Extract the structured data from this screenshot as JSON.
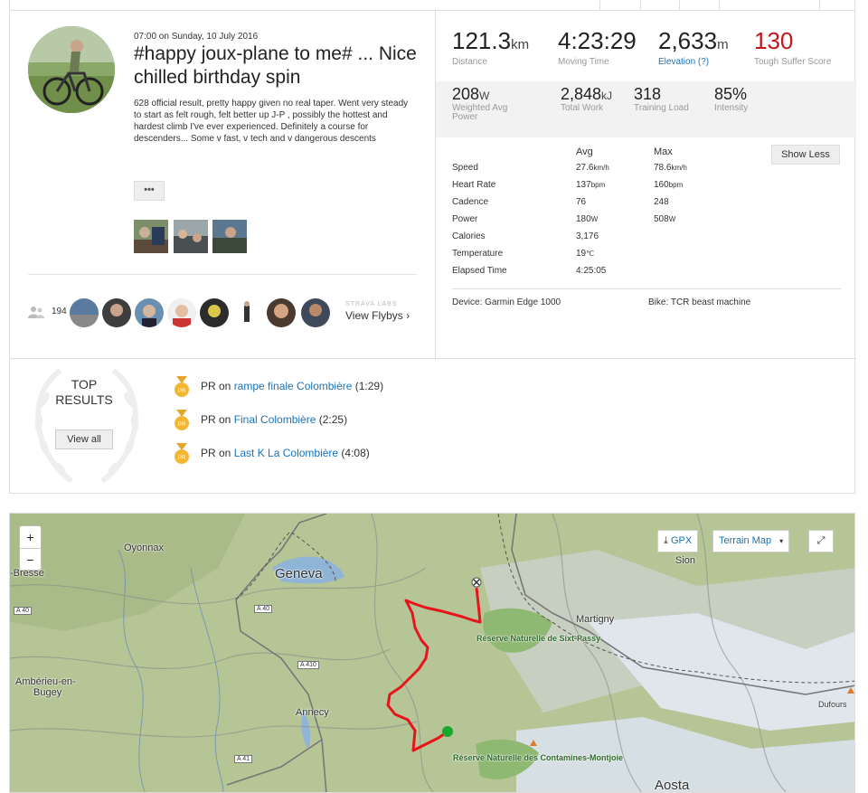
{
  "activity": {
    "date": "07:00 on Sunday, 10 July 2016",
    "title": "#happy joux-plane to me# ... Nice chilled birthday spin",
    "description": "628 official result, pretty happy given no real taper. Went very steady to start as felt rough, felt better up J-P , possibly the hottest and hardest climb I've ever experienced. Definitely a course for descenders... Some v fast, v tech and v dangerous descents",
    "more_label": "•••",
    "photos": [
      "photo-1",
      "photo-2",
      "photo-3"
    ]
  },
  "kudos": {
    "count": "194",
    "labs_label": "STRAVA LABS",
    "flyby_label": "View Flybys ›"
  },
  "stats": {
    "distance": {
      "value": "121.3",
      "unit": "km",
      "label": "Distance"
    },
    "moving_time": {
      "value": "4:23:29",
      "label": "Moving Time"
    },
    "elevation": {
      "value": "2,633",
      "unit": "m",
      "label": "Elevation (?)"
    },
    "suffer": {
      "value": "130",
      "label": "Tough Suffer Score"
    },
    "weighted_power": {
      "value": "208",
      "unit": "W",
      "label": "Weighted Avg Power"
    },
    "total_work": {
      "value": "2,848",
      "unit": "kJ",
      "label": "Total Work"
    },
    "training_load": {
      "value": "318",
      "label": "Training Load"
    },
    "intensity": {
      "value": "85%",
      "label": "Intensity"
    }
  },
  "details": {
    "avg_header": "Avg",
    "max_header": "Max",
    "show_less_label": "Show Less",
    "rows": [
      {
        "label": "Speed",
        "avg": "27.6",
        "avg_unit": "km/h",
        "max": "78.6",
        "max_unit": "km/h"
      },
      {
        "label": "Heart Rate",
        "avg": "137",
        "avg_unit": "bpm",
        "max": "160",
        "max_unit": "bpm"
      },
      {
        "label": "Cadence",
        "avg": "76",
        "avg_unit": "",
        "max": "248",
        "max_unit": ""
      },
      {
        "label": "Power",
        "avg": "180",
        "avg_unit": "W",
        "max": "508",
        "max_unit": "W"
      },
      {
        "label": "Calories",
        "avg": "3,176",
        "avg_unit": "",
        "max": "",
        "max_unit": ""
      },
      {
        "label": "Temperature",
        "avg": "19",
        "avg_unit": "℃",
        "max": "",
        "max_unit": ""
      },
      {
        "label": "Elapsed Time",
        "avg": "4:25:05",
        "avg_unit": "",
        "max": "",
        "max_unit": ""
      }
    ],
    "device": "Device: Garmin Edge 1000",
    "bike": "Bike: TCR beast machine"
  },
  "top_results": {
    "title_line1": "TOP",
    "title_line2": "RESULTS",
    "view_all_label": "View all",
    "items": [
      {
        "prefix": "PR on ",
        "segment": "rampe finale Colombière",
        "time": " (1:29)"
      },
      {
        "prefix": "PR on ",
        "segment": "Final Colombière",
        "time": " (2:25)"
      },
      {
        "prefix": "PR on ",
        "segment": "Last K La Colombière",
        "time": " (4:08)"
      }
    ]
  },
  "map": {
    "zoom_in": "+",
    "zoom_out": "−",
    "gpx_label": "GPX",
    "map_type_label": "Terrain Map",
    "labels": {
      "oyonnax": "Oyonnax",
      "bresse": "-Bresse",
      "geneva": "Geneva",
      "sion": "Sion",
      "martigny": "Martigny",
      "ambarieu": "Ambérieu-en-",
      "bugey": "Bugey",
      "annecy": "Annecy",
      "aosta": "Aosta",
      "dufours": "Dufours",
      "sixt": "Réserve Naturelle de Sixt-Passy",
      "contamines": "Réserve Naturelle des Contamines-Montjoie"
    },
    "roads": {
      "a40a": "A 40",
      "a40b": "A 40",
      "a410": "A 410",
      "a41": "A 41"
    },
    "colors": {
      "route": "#e8141c",
      "start": "#19a82e",
      "link": "#1a73b8",
      "suffer": "#c0171c"
    }
  }
}
